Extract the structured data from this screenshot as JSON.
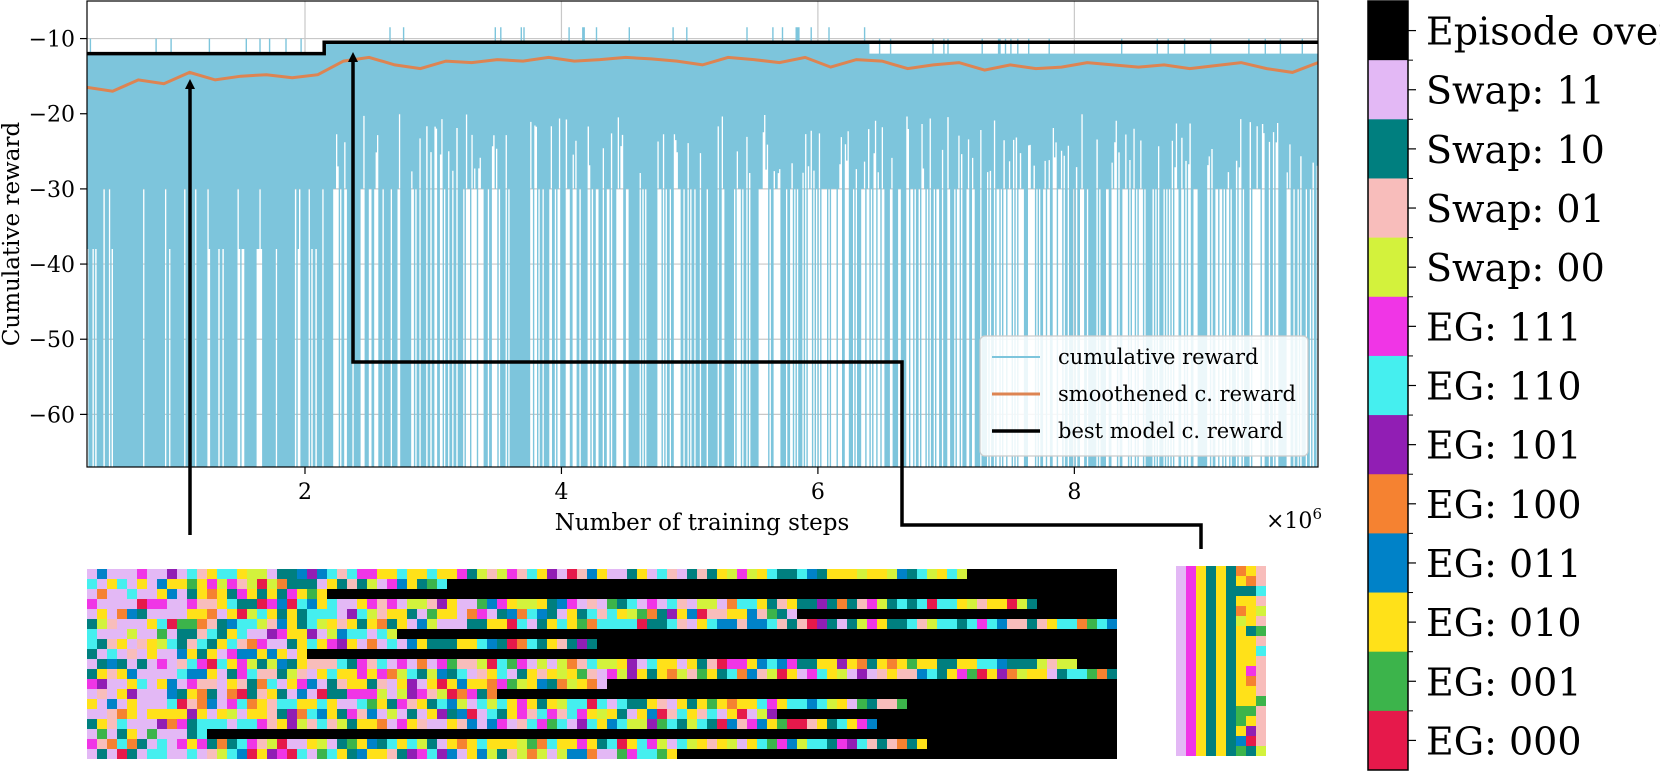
{
  "chart_data": [
    {
      "type": "line",
      "xlabel": "Number of training steps",
      "ylabel": "Cumulative reward",
      "x_multiplier_label": "×10^6",
      "x_multiplier_base": "×10",
      "x_multiplier_exp": "6",
      "xlim": [
        0.3,
        9.9
      ],
      "ylim": [
        -67,
        -5
      ],
      "xticks": [
        2,
        4,
        6,
        8
      ],
      "yticks": [
        -60,
        -50,
        -40,
        -30,
        -20,
        -10
      ],
      "grid": true,
      "legend_position": "lower-right",
      "legend": [
        "cumulative reward",
        "smoothened c. reward",
        "best model c. reward"
      ],
      "series": [
        {
          "name": "cumulative reward",
          "color": "#7dc5dc",
          "note_values": "dense raw episode rewards, mostly between -67 and -12, frequent peaks near -10",
          "upper_envelope": [
            [
              0.3,
              -12
            ],
            [
              2.15,
              -12
            ],
            [
              2.15,
              -10.5
            ],
            [
              6.4,
              -10.5
            ],
            [
              6.4,
              -12
            ],
            [
              9.9,
              -12
            ]
          ]
        },
        {
          "name": "smoothened c. reward",
          "color": "#dd8452",
          "x": [
            0.3,
            0.5,
            0.7,
            0.9,
            1.1,
            1.3,
            1.5,
            1.7,
            1.9,
            2.1,
            2.3,
            2.5,
            2.7,
            2.9,
            3.1,
            3.3,
            3.5,
            3.7,
            3.9,
            4.1,
            4.3,
            4.5,
            4.7,
            4.9,
            5.1,
            5.3,
            5.5,
            5.7,
            5.9,
            6.1,
            6.3,
            6.5,
            6.7,
            6.9,
            7.1,
            7.3,
            7.5,
            7.7,
            7.9,
            8.1,
            8.3,
            8.5,
            8.7,
            8.9,
            9.1,
            9.3,
            9.5,
            9.7,
            9.9
          ],
          "y": [
            -16.5,
            -17,
            -15.5,
            -16,
            -14.5,
            -15.5,
            -15,
            -14.8,
            -15.2,
            -14.8,
            -13,
            -12.5,
            -13.5,
            -14,
            -13,
            -13.2,
            -12.8,
            -13,
            -12.5,
            -13,
            -12.8,
            -12.5,
            -12.7,
            -13,
            -13.5,
            -12.5,
            -12.8,
            -13.2,
            -12.5,
            -13.8,
            -12.8,
            -13,
            -14,
            -13.5,
            -13.2,
            -14.2,
            -13.5,
            -14,
            -13.8,
            -13.2,
            -13.5,
            -13.8,
            -13.5,
            -14,
            -13.6,
            -13.2,
            -14,
            -14.5,
            -13.2
          ]
        },
        {
          "name": "best model c. reward",
          "color": "#000000",
          "x": [
            0.3,
            2.15,
            2.15,
            9.9
          ],
          "y": [
            -12,
            -12,
            -10.5,
            -10.5
          ]
        }
      ],
      "annotations": [
        {
          "type": "arrow",
          "from": "left action grid",
          "to_x": 1.1,
          "to_y": -13
        },
        {
          "type": "arrow",
          "from": "right action grid",
          "to_x": 2.25,
          "to_y": -12
        }
      ]
    },
    {
      "type": "heatmap",
      "description": "Action sequence grids per episode (rows) for two models; colors per legend",
      "legend": [
        {
          "label": "Episode over",
          "color": "#000000"
        },
        {
          "label": "Swap: 11",
          "color": "#e3b8f5"
        },
        {
          "label": "Swap: 10",
          "color": "#007f7f"
        },
        {
          "label": "Swap: 01",
          "color": "#f8bdbb"
        },
        {
          "label": "Swap: 00",
          "color": "#d3f23c"
        },
        {
          "label": "EG: 111",
          "color": "#f035e6"
        },
        {
          "label": "EG: 110",
          "color": "#45efef"
        },
        {
          "label": "EG: 101",
          "color": "#911eb4"
        },
        {
          "label": "EG: 100",
          "color": "#f58231"
        },
        {
          "label": "EG: 011",
          "color": "#0082c8"
        },
        {
          "label": "EG: 010",
          "color": "#ffe119"
        },
        {
          "label": "EG: 001",
          "color": "#3cb44b"
        },
        {
          "label": "EG: 000",
          "color": "#e6194b"
        }
      ]
    }
  ]
}
